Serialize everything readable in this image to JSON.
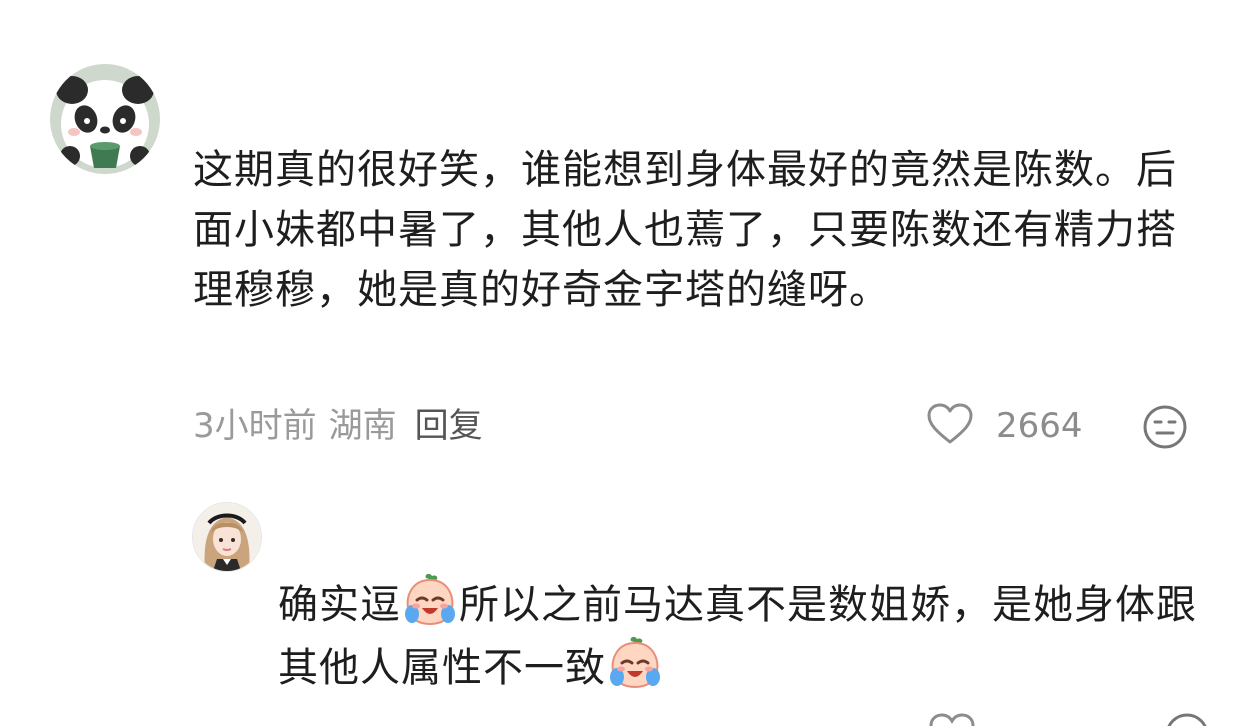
{
  "comments": [
    {
      "text": "这期真的很好笑，谁能想到身体最好的竟然是陈数。后面小妹都中暑了，其他人也蔫了，只要陈数还有精力搭理穆穆，她是真的好奇金字塔的缝呀。",
      "time": "3小时前",
      "location": "湖南",
      "reply_label": "回复",
      "likes": "2664",
      "avatar_icon": "panda-avatar-icon",
      "like_icon": "heart-icon",
      "reaction_icon": "neutral-face-icon"
    }
  ],
  "reply": {
    "text_part1": "确实逗",
    "text_part2": "所以之前马达真不是数姐娇，是她身体跟其他人属性不一致",
    "emoji_icon": "crying-peach-emoji-icon",
    "avatar_icon": "girl-avatar-icon"
  },
  "colors": {
    "text": "#1e1e1e",
    "meta": "#9a9a9a",
    "reply_label": "#555555",
    "like_count": "#8c8c8c"
  }
}
